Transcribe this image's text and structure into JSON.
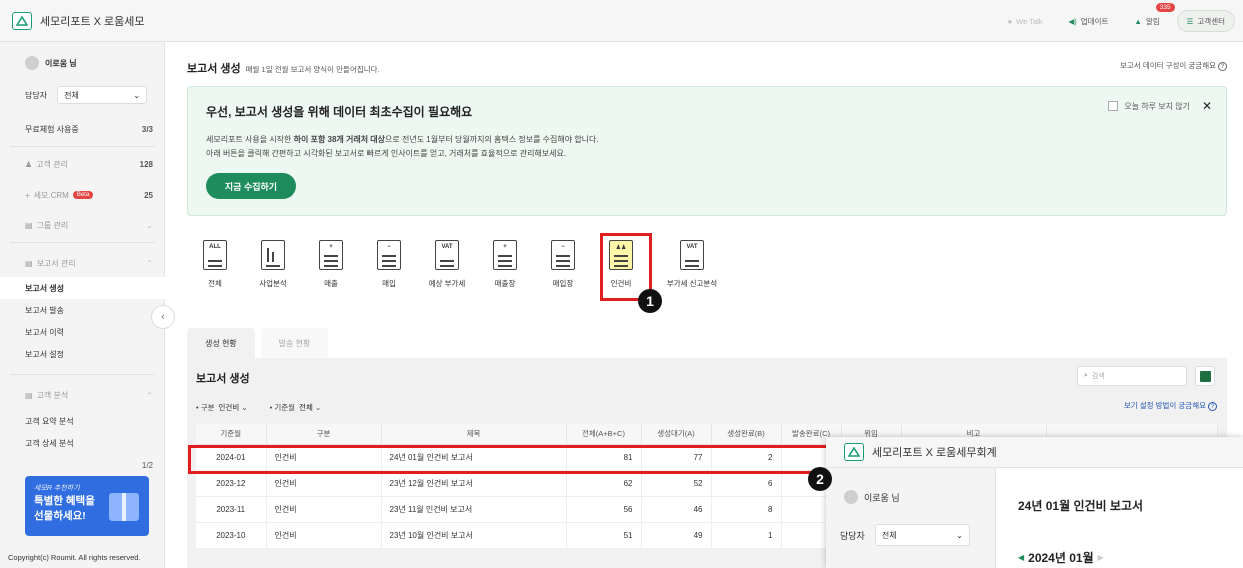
{
  "topbar": {
    "brand": "세모리포트 X 로움세모",
    "wetalk": "We Talk",
    "update": "업데이트",
    "alarm": "알림",
    "alarm_count": "335",
    "support": "고객센터"
  },
  "sidebar": {
    "user": "이로움 님",
    "manager_label": "담당자",
    "manager_value": "전체",
    "trial_label": "무료체험 사용중",
    "trial_value": "3/3",
    "customer_mgmt": "고객 관리",
    "customer_count": "128",
    "crm": "세모.CRM",
    "crm_badge": "Beta",
    "crm_count": "25",
    "group_mgmt": "그룹 관리",
    "report_mgmt": "보고서 관리",
    "report_items": [
      "보고서 생성",
      "보고서 발송",
      "보고서 이력",
      "보고서 설정"
    ],
    "analysis": "고객 분석",
    "analysis_items": [
      "고객 요약 분석",
      "고객 상세 분석"
    ],
    "page_indicator": "1/2",
    "promo_small": "세모R 추천하기",
    "promo_line1": "특별한 혜택을",
    "promo_line2": "선물하세요!",
    "copyright": "Copyright(c) Roumit. All rights reserved."
  },
  "main": {
    "title": "보고서 생성",
    "subtitle": "매월 1일 전월 보고서 양식이 만들어집니다.",
    "help": "보고서 데이터 구성이 궁금해요"
  },
  "banner": {
    "title": "우선, 보고서 생성을 위해 데이터 최초수집이 필요해요",
    "desc1_pre": "세모리포트 사용을 시작한 ",
    "desc1_bold": "하이 포함 38개 거래처 대상",
    "desc1_post": "으로 전년도 1월부터 당월까지의 홈텍스 정보를 수집해야 합니다.",
    "desc2": "아래 버튼을 클릭해 간편하고 시각화된 보고서로 빠르게 인사이트를 얻고, 거래처를 효율적으로 관리해보세요.",
    "button": "지금 수집하기",
    "dismiss": "오늘 하루 보지 않기"
  },
  "categories": [
    {
      "label": "전체",
      "icon": "ALL"
    },
    {
      "label": "사업분석",
      "icon": ""
    },
    {
      "label": "매출",
      "icon": ""
    },
    {
      "label": "매입",
      "icon": ""
    },
    {
      "label": "예상 부가세",
      "icon": "VAT"
    },
    {
      "label": "매출장",
      "icon": ""
    },
    {
      "label": "매입장",
      "icon": ""
    },
    {
      "label": "인건비",
      "icon": ""
    },
    {
      "label": "부가세 신고분석",
      "icon": "VAT"
    }
  ],
  "markers": {
    "one": "1",
    "two": "2"
  },
  "tabs": {
    "active": "생성 현황",
    "inactive": "발송 현황"
  },
  "report": {
    "title": "보고서 생성",
    "search_placeholder": "검색",
    "filter1_label": "구분",
    "filter1_value": "인건비",
    "filter2_label": "기준월",
    "filter2_value": "전체",
    "help": "보기 설정 방법이 궁금해요",
    "headers": [
      "기준월",
      "구분",
      "제목",
      "전체(A+B+C)",
      "생성대기(A)",
      "생성완료(B)",
      "발송완료(C)",
      "위임",
      "비고"
    ],
    "rows": [
      [
        "2024-01",
        "인건비",
        "24년 01월 인건비 보고서",
        "81",
        "77",
        "2"
      ],
      [
        "2023-12",
        "인건비",
        "23년 12월 인건비 보고서",
        "62",
        "52",
        "6"
      ],
      [
        "2023-11",
        "인건비",
        "23년 11월 인건비 보고서",
        "56",
        "46",
        "8"
      ],
      [
        "2023-10",
        "인건비",
        "23년 10월 인건비 보고서",
        "51",
        "49",
        "1"
      ]
    ]
  },
  "popup": {
    "brand": "세모리포트 X 로움세무회계",
    "user": "이로움 님",
    "manager_label": "담당자",
    "manager_value": "전체",
    "title": "24년 01월 인건비 보고서",
    "month": "2024년 01월"
  },
  "colors": {
    "accent": "#1e8c5c",
    "highlight": "#e11d1d",
    "waiting": "#e23b3b",
    "done": "#2460d6"
  }
}
